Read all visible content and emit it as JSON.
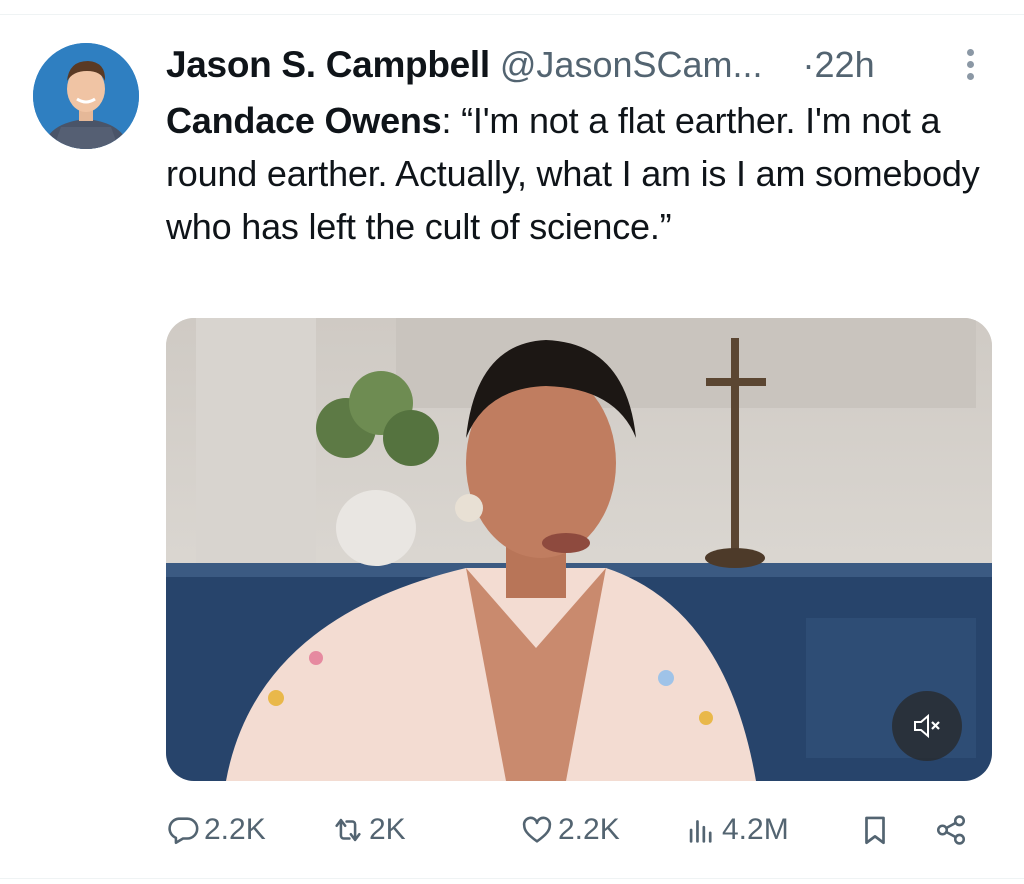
{
  "tweet": {
    "author_name": "Jason S. Campbell",
    "author_handle": "@JasonSCam...",
    "timestamp": "22h",
    "separator": "·",
    "quoted_speaker": "Candace Owens",
    "quote_body": ": “I'm not a flat earther. I'm not a round earther. Actually, what I am is I am somebody who has left the cult of science.”"
  },
  "media": {
    "type": "video",
    "muted": true
  },
  "actions": {
    "replies": "2.2K",
    "reposts": "2K",
    "likes": "2.2K",
    "views": "4.2M"
  },
  "icons": [
    "more-icon",
    "reply-icon",
    "repost-icon",
    "like-icon",
    "views-icon",
    "bookmark-icon",
    "share-icon",
    "mute-icon"
  ],
  "colors": {
    "text": "#0f1419",
    "muted_text": "#536471",
    "divider": "#eff3f4"
  }
}
